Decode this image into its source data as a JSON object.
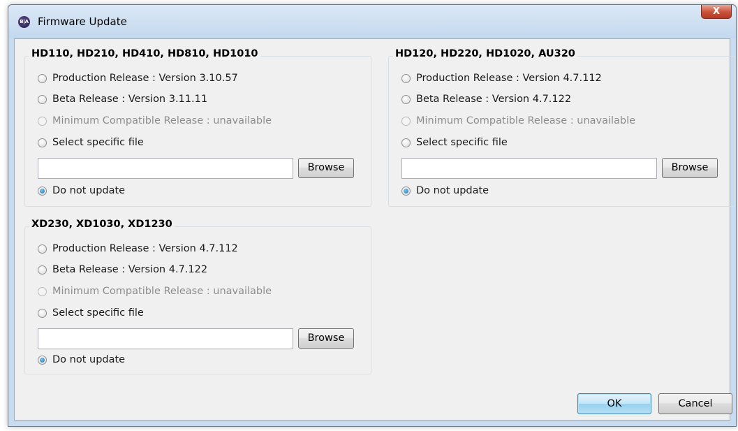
{
  "window": {
    "title": "Firmware Update",
    "app_icon_text": "B|A",
    "close_glyph": "X"
  },
  "groups": [
    {
      "title": "HD110, HD210, HD410, HD810, HD1010",
      "options": [
        {
          "label": "Production Release : Version 3.10.57",
          "enabled": true,
          "checked": false
        },
        {
          "label": "Beta Release : Version 3.11.11",
          "enabled": true,
          "checked": false
        },
        {
          "label": "Minimum Compatible Release : unavailable",
          "enabled": false,
          "checked": false
        },
        {
          "label": "Select specific file",
          "enabled": true,
          "checked": false
        }
      ],
      "file_value": "",
      "browse_label": "Browse",
      "no_update_label": "Do not update",
      "no_update_checked": true
    },
    {
      "title": "HD120, HD220, HD1020, AU320",
      "options": [
        {
          "label": "Production Release : Version 4.7.112",
          "enabled": true,
          "checked": false
        },
        {
          "label": "Beta Release : Version 4.7.122",
          "enabled": true,
          "checked": false
        },
        {
          "label": "Minimum Compatible Release : unavailable",
          "enabled": false,
          "checked": false
        },
        {
          "label": "Select specific file",
          "enabled": true,
          "checked": false
        }
      ],
      "file_value": "",
      "browse_label": "Browse",
      "no_update_label": "Do not update",
      "no_update_checked": true
    },
    {
      "title": "XD230, XD1030, XD1230",
      "options": [
        {
          "label": "Production Release : Version 4.7.112",
          "enabled": true,
          "checked": false
        },
        {
          "label": "Beta Release : Version 4.7.122",
          "enabled": true,
          "checked": false
        },
        {
          "label": "Minimum Compatible Release : unavailable",
          "enabled": false,
          "checked": false
        },
        {
          "label": "Select specific file",
          "enabled": true,
          "checked": false
        }
      ],
      "file_value": "",
      "browse_label": "Browse",
      "no_update_label": "Do not update",
      "no_update_checked": true
    }
  ],
  "buttons": {
    "ok_label": "OK",
    "cancel_label": "Cancel"
  }
}
